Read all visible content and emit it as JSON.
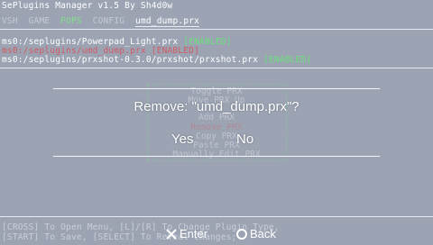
{
  "app": {
    "title": "SePlugins Manager v1.5 By Sh4d0w"
  },
  "tabs": [
    {
      "label": "VSH"
    },
    {
      "label": "GAME"
    },
    {
      "label": "POPS"
    },
    {
      "label": "CONFIG"
    },
    {
      "label": "umd_dump.prx"
    }
  ],
  "plugins": [
    {
      "path": "ms0:/seplugins/Powerpad_Light.prx",
      "status": "[ENABLED]"
    },
    {
      "path": "ms0:/seplugins/umd_dump.prx",
      "status": "[ENABLED]"
    },
    {
      "path": "ms0:/seplugins/prxshot-0.3.0/prxshot/prxshot.prx",
      "status": "[ENABLED]"
    }
  ],
  "menu": {
    "items": [
      {
        "label": "Toggle PRX"
      },
      {
        "label": "Move PRX Up"
      },
      {
        "label": "Add PRX"
      },
      {
        "label": "Remove PRX"
      },
      {
        "label": "Copy PRX"
      },
      {
        "label": "Paste PRX"
      },
      {
        "label": "Manually Edit PRX"
      }
    ]
  },
  "dialog": {
    "message": "Remove: \"umd_dump.prx\"?",
    "yes_label": "Yes",
    "no_label": "No"
  },
  "help": {
    "line1": "[CROSS] To Open Menu, [L]/[R] To Change Plugin Type,",
    "line2": "[START] To Save, [SELECT] To Reveal Changes;"
  },
  "hints": {
    "enter_label": "Enter",
    "back_label": "Back"
  },
  "colors": {
    "background": "#9ca4b4",
    "enabled": "#6ae07a",
    "selected": "#d15b63",
    "active_tab": "#7fe08c"
  }
}
